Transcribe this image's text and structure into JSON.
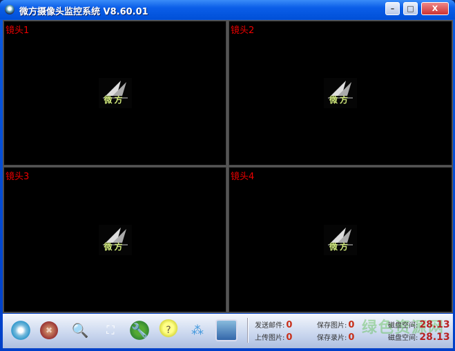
{
  "window": {
    "title": "微方摄像头监控系统 V8.60.01",
    "minimize": "–",
    "maximize": "□",
    "close": "X"
  },
  "panes": [
    {
      "label": "镜头1"
    },
    {
      "label": "镜头2"
    },
    {
      "label": "镜头3"
    },
    {
      "label": "镜头4"
    }
  ],
  "logo_text": "微方",
  "toolbar": {
    "buttons": [
      "camera",
      "stop",
      "zoom",
      "fullscreen",
      "settings",
      "help",
      "network",
      "photos"
    ]
  },
  "stats": {
    "send_mail_label": "发送邮件:",
    "send_mail": "0",
    "upload_label": "上传图片:",
    "upload": "0",
    "save_photo_label": "保存图片:",
    "save_photo": "0",
    "save_video_label": "保存录片:",
    "save_video": "0",
    "disk1_label": "磁盘空间:",
    "disk1": "28.13",
    "disk2_label": "磁盘空间:",
    "disk2": "28.13"
  },
  "watermark": "绿色资源网"
}
